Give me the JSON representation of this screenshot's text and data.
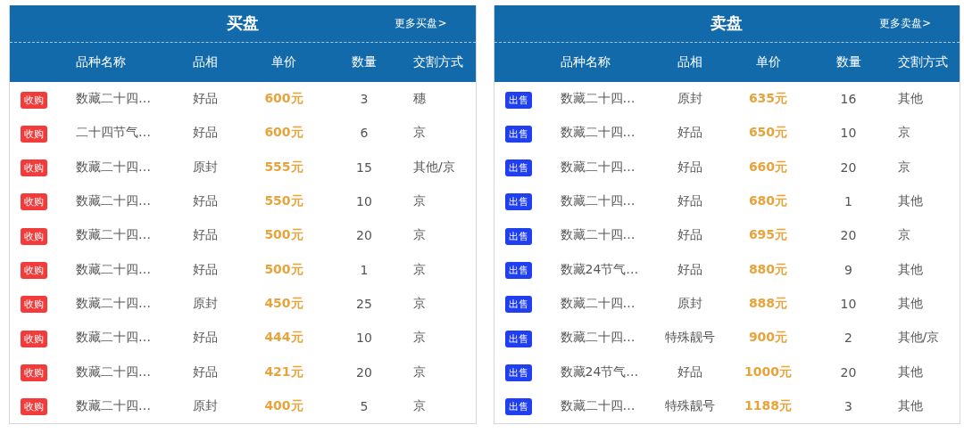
{
  "panels": [
    {
      "kind": "buy",
      "title": "买盘",
      "more_link": "更多买盘>",
      "columns": [
        "品种名称",
        "品相",
        "单价",
        "数量",
        "交割方式"
      ],
      "rows": [
        {
          "badge": "收购",
          "name": "数藏二十四…",
          "quality": "好品",
          "price": "600元",
          "quantity": "3",
          "delivery": "穗"
        },
        {
          "badge": "收购",
          "name": "二十四节气…",
          "quality": "好品",
          "price": "600元",
          "quantity": "6",
          "delivery": "京"
        },
        {
          "badge": "收购",
          "name": "数藏二十四…",
          "quality": "原封",
          "price": "555元",
          "quantity": "15",
          "delivery": "其他/京"
        },
        {
          "badge": "收购",
          "name": "数藏二十四…",
          "quality": "好品",
          "price": "550元",
          "quantity": "10",
          "delivery": "京"
        },
        {
          "badge": "收购",
          "name": "数藏二十四…",
          "quality": "好品",
          "price": "500元",
          "quantity": "20",
          "delivery": "京"
        },
        {
          "badge": "收购",
          "name": "数藏二十四…",
          "quality": "好品",
          "price": "500元",
          "quantity": "1",
          "delivery": "京"
        },
        {
          "badge": "收购",
          "name": "数藏二十四…",
          "quality": "原封",
          "price": "450元",
          "quantity": "25",
          "delivery": "京"
        },
        {
          "badge": "收购",
          "name": "数藏二十四…",
          "quality": "好品",
          "price": "444元",
          "quantity": "10",
          "delivery": "京"
        },
        {
          "badge": "收购",
          "name": "数藏二十四…",
          "quality": "好品",
          "price": "421元",
          "quantity": "20",
          "delivery": "京"
        },
        {
          "badge": "收购",
          "name": "数藏二十四…",
          "quality": "原封",
          "price": "400元",
          "quantity": "5",
          "delivery": "京"
        }
      ]
    },
    {
      "kind": "sell",
      "title": "卖盘",
      "more_link": "更多卖盘>",
      "columns": [
        "品种名称",
        "品相",
        "单价",
        "数量",
        "交割方式"
      ],
      "rows": [
        {
          "badge": "出售",
          "name": "数藏二十四…",
          "quality": "原封",
          "price": "635元",
          "quantity": "16",
          "delivery": "其他"
        },
        {
          "badge": "出售",
          "name": "数藏二十四…",
          "quality": "好品",
          "price": "650元",
          "quantity": "10",
          "delivery": "京"
        },
        {
          "badge": "出售",
          "name": "数藏二十四…",
          "quality": "好品",
          "price": "660元",
          "quantity": "20",
          "delivery": "京"
        },
        {
          "badge": "出售",
          "name": "数藏二十四…",
          "quality": "好品",
          "price": "680元",
          "quantity": "1",
          "delivery": "其他"
        },
        {
          "badge": "出售",
          "name": "数藏二十四…",
          "quality": "好品",
          "price": "695元",
          "quantity": "20",
          "delivery": "京"
        },
        {
          "badge": "出售",
          "name": "数藏24节气…",
          "quality": "好品",
          "price": "880元",
          "quantity": "9",
          "delivery": "其他"
        },
        {
          "badge": "出售",
          "name": "数藏二十四…",
          "quality": "原封",
          "price": "888元",
          "quantity": "10",
          "delivery": "其他"
        },
        {
          "badge": "出售",
          "name": "数藏二十四…",
          "quality": "特殊靓号",
          "price": "900元",
          "quantity": "2",
          "delivery": "其他/京"
        },
        {
          "badge": "出售",
          "name": "数藏24节气…",
          "quality": "好品",
          "price": "1000元",
          "quantity": "20",
          "delivery": "其他"
        },
        {
          "badge": "出售",
          "name": "数藏二十四…",
          "quality": "特殊靓号",
          "price": "1188元",
          "quantity": "3",
          "delivery": "其他"
        }
      ]
    }
  ]
}
